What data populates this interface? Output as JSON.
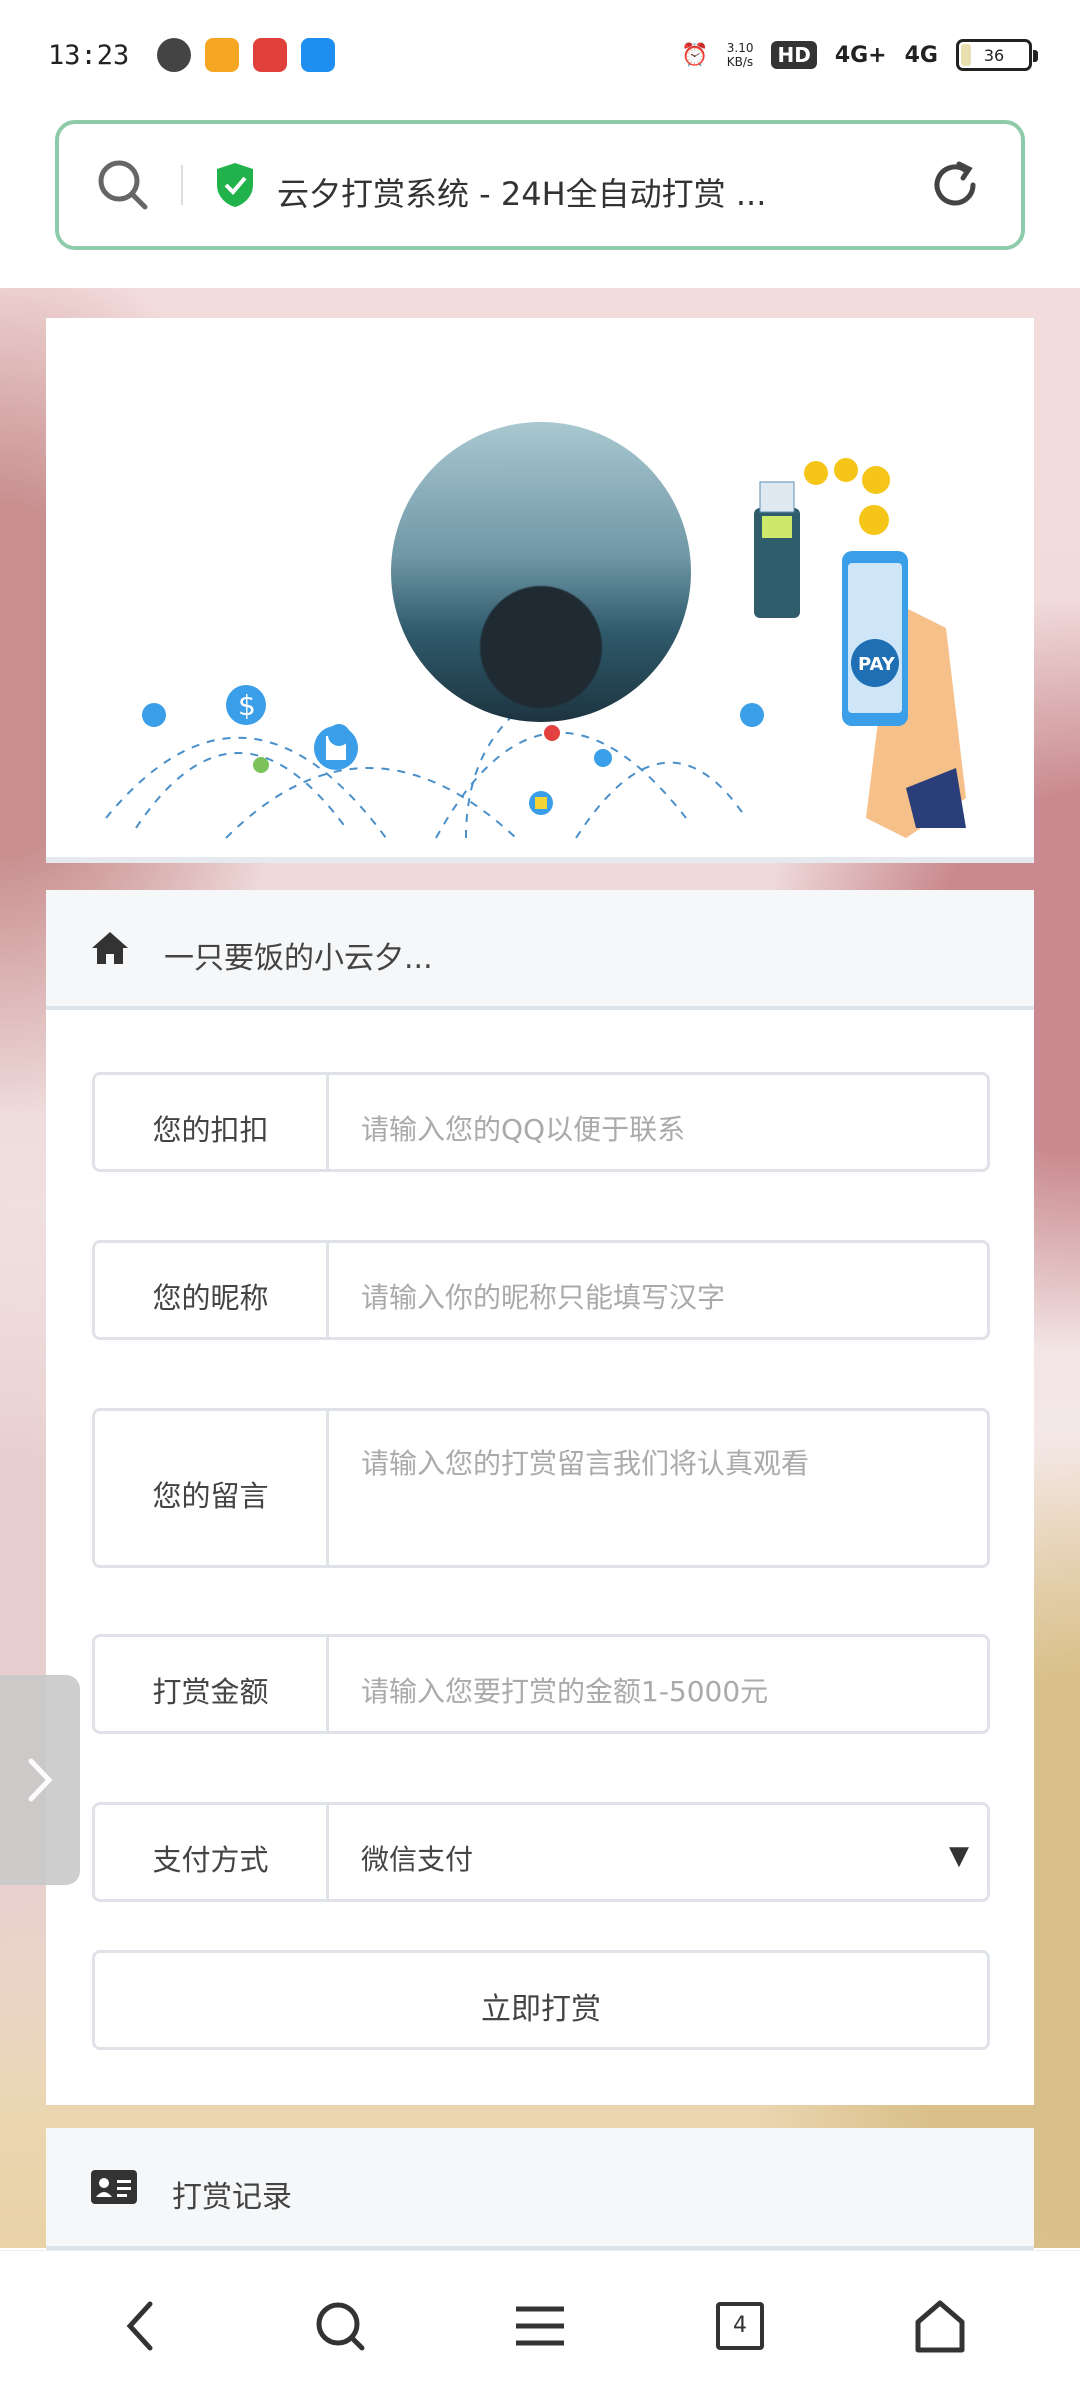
{
  "status_bar": {
    "time": "13:23",
    "net_speed": "3.10\nKB/s",
    "hd_label": "HD",
    "sim1": "4G+",
    "sim2": "4G",
    "battery": "36"
  },
  "address_bar": {
    "title": "云夕打赏系统 - 24H全自动打赏 ..."
  },
  "intro": {
    "label": "一只要饭的小云夕..."
  },
  "form": {
    "rows": [
      {
        "key": "您的扣扣",
        "placeholder": "请输入您的QQ以便于联系"
      },
      {
        "key": "您的昵称",
        "placeholder": "请输入你的昵称只能填写汉字"
      },
      {
        "key": "您的留言",
        "placeholder": "请输入您的打赏留言我们将认真观看"
      },
      {
        "key": "打赏金额",
        "placeholder": "请输入您要打赏的金额1-5000元"
      },
      {
        "key": "支付方式",
        "value": "微信支付"
      }
    ],
    "submit": "立即打赏"
  },
  "records": {
    "label": "打赏记录"
  },
  "bottom_nav": {
    "tab_count": "4"
  },
  "colors": {
    "address_border": "#8ecbab",
    "shield_green": "#22b24c"
  }
}
